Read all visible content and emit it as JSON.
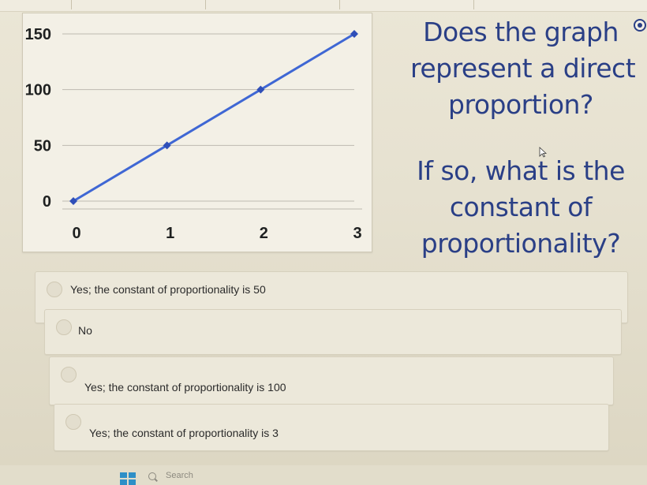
{
  "question": {
    "lines": [
      "Does the graph",
      "represent a direct",
      "proportion?",
      "If so, what is the",
      "constant of",
      "proportionality?"
    ]
  },
  "options": [
    {
      "label": "Yes; the constant of proportionality is 50"
    },
    {
      "label": "No"
    },
    {
      "label": "Yes; the constant of proportionality is 100"
    },
    {
      "label": "Yes; the constant of proportionality is 3"
    }
  ],
  "taskbar": {
    "search_placeholder": "Search"
  },
  "colors": {
    "line": "#3f67d4",
    "text_blue": "#2a3f86",
    "grid": "#bdbab0"
  },
  "icons": [
    "settings-icon",
    "cursor-icon",
    "windows-start-icon",
    "search-icon"
  ],
  "chart_data": {
    "type": "line",
    "x": [
      0,
      1,
      2,
      3
    ],
    "series": [
      {
        "values": [
          0,
          50,
          100,
          150
        ]
      }
    ],
    "x_ticks": [
      "0",
      "1",
      "2",
      "3"
    ],
    "y_ticks": [
      "0",
      "50",
      "100",
      "150"
    ],
    "xlim": [
      0,
      3
    ],
    "ylim": [
      0,
      150
    ],
    "grid": true,
    "title": "",
    "xlabel": "",
    "ylabel": ""
  }
}
